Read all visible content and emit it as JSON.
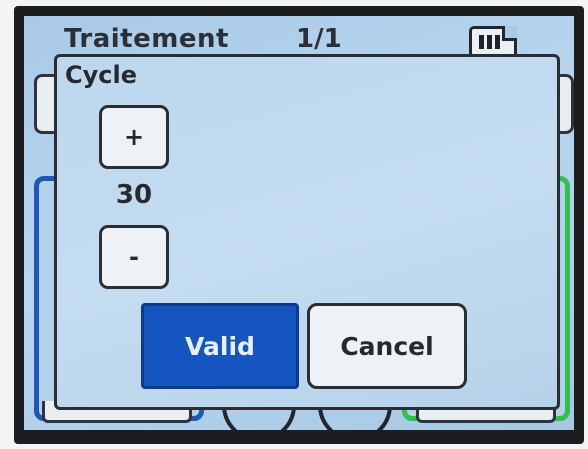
{
  "header": {
    "title": "Traitement",
    "page": "1/1",
    "storage_icon": "sd-card-icon"
  },
  "dialog": {
    "title": "Cycle",
    "increment_label": "+",
    "value": "30",
    "decrement_label": "-",
    "valid_label": "Valid",
    "cancel_label": "Cancel"
  },
  "colors": {
    "screen_background": "#a9c9e6",
    "valid_button": "#1555c0",
    "left_panel_border": "#1f57b8",
    "right_panel_border": "#2fc24a"
  }
}
